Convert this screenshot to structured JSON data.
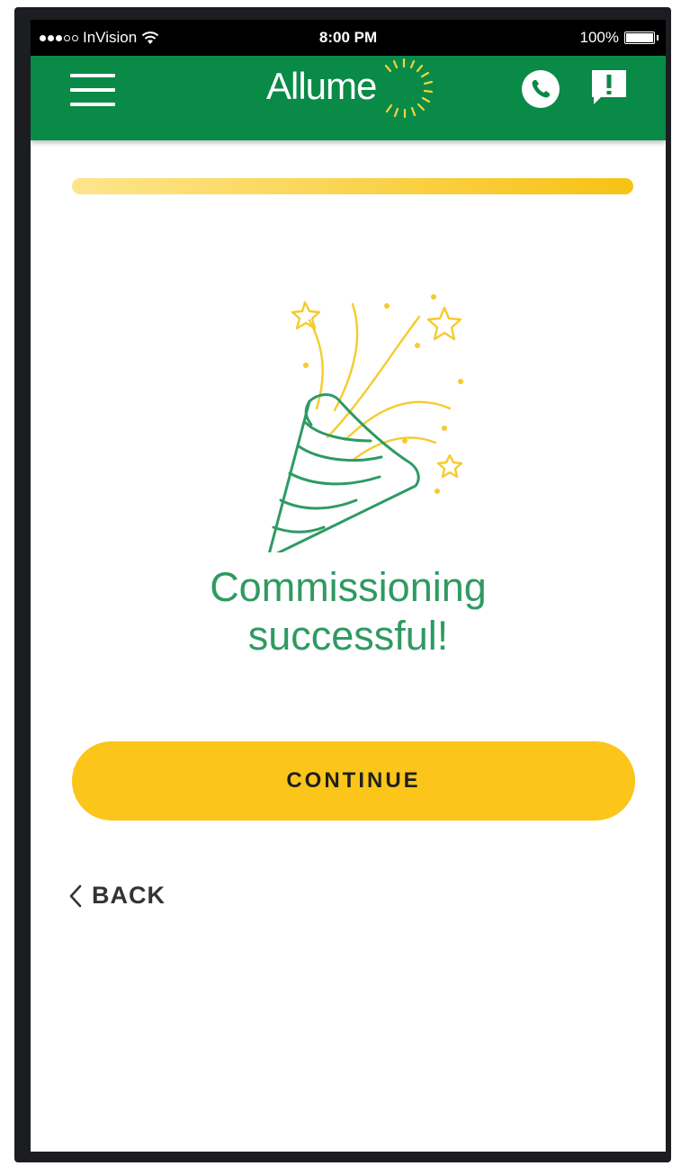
{
  "status_bar": {
    "carrier": "InVision",
    "time": "8:00 PM",
    "battery": "100%"
  },
  "header": {
    "logo_text": "Allume",
    "menu_icon": "hamburger-menu-icon",
    "call_icon": "phone-icon",
    "feedback_icon": "feedback-exclamation-icon",
    "color": "#0a8a47"
  },
  "progress": {
    "value": 1.0
  },
  "illustration": {
    "icon": "party-popper-icon"
  },
  "message": {
    "line1": "Commissioning",
    "line2": "successful!"
  },
  "actions": {
    "continue_label": "CONTINUE",
    "back_label": "BACK",
    "accent": "#fbc51a"
  }
}
